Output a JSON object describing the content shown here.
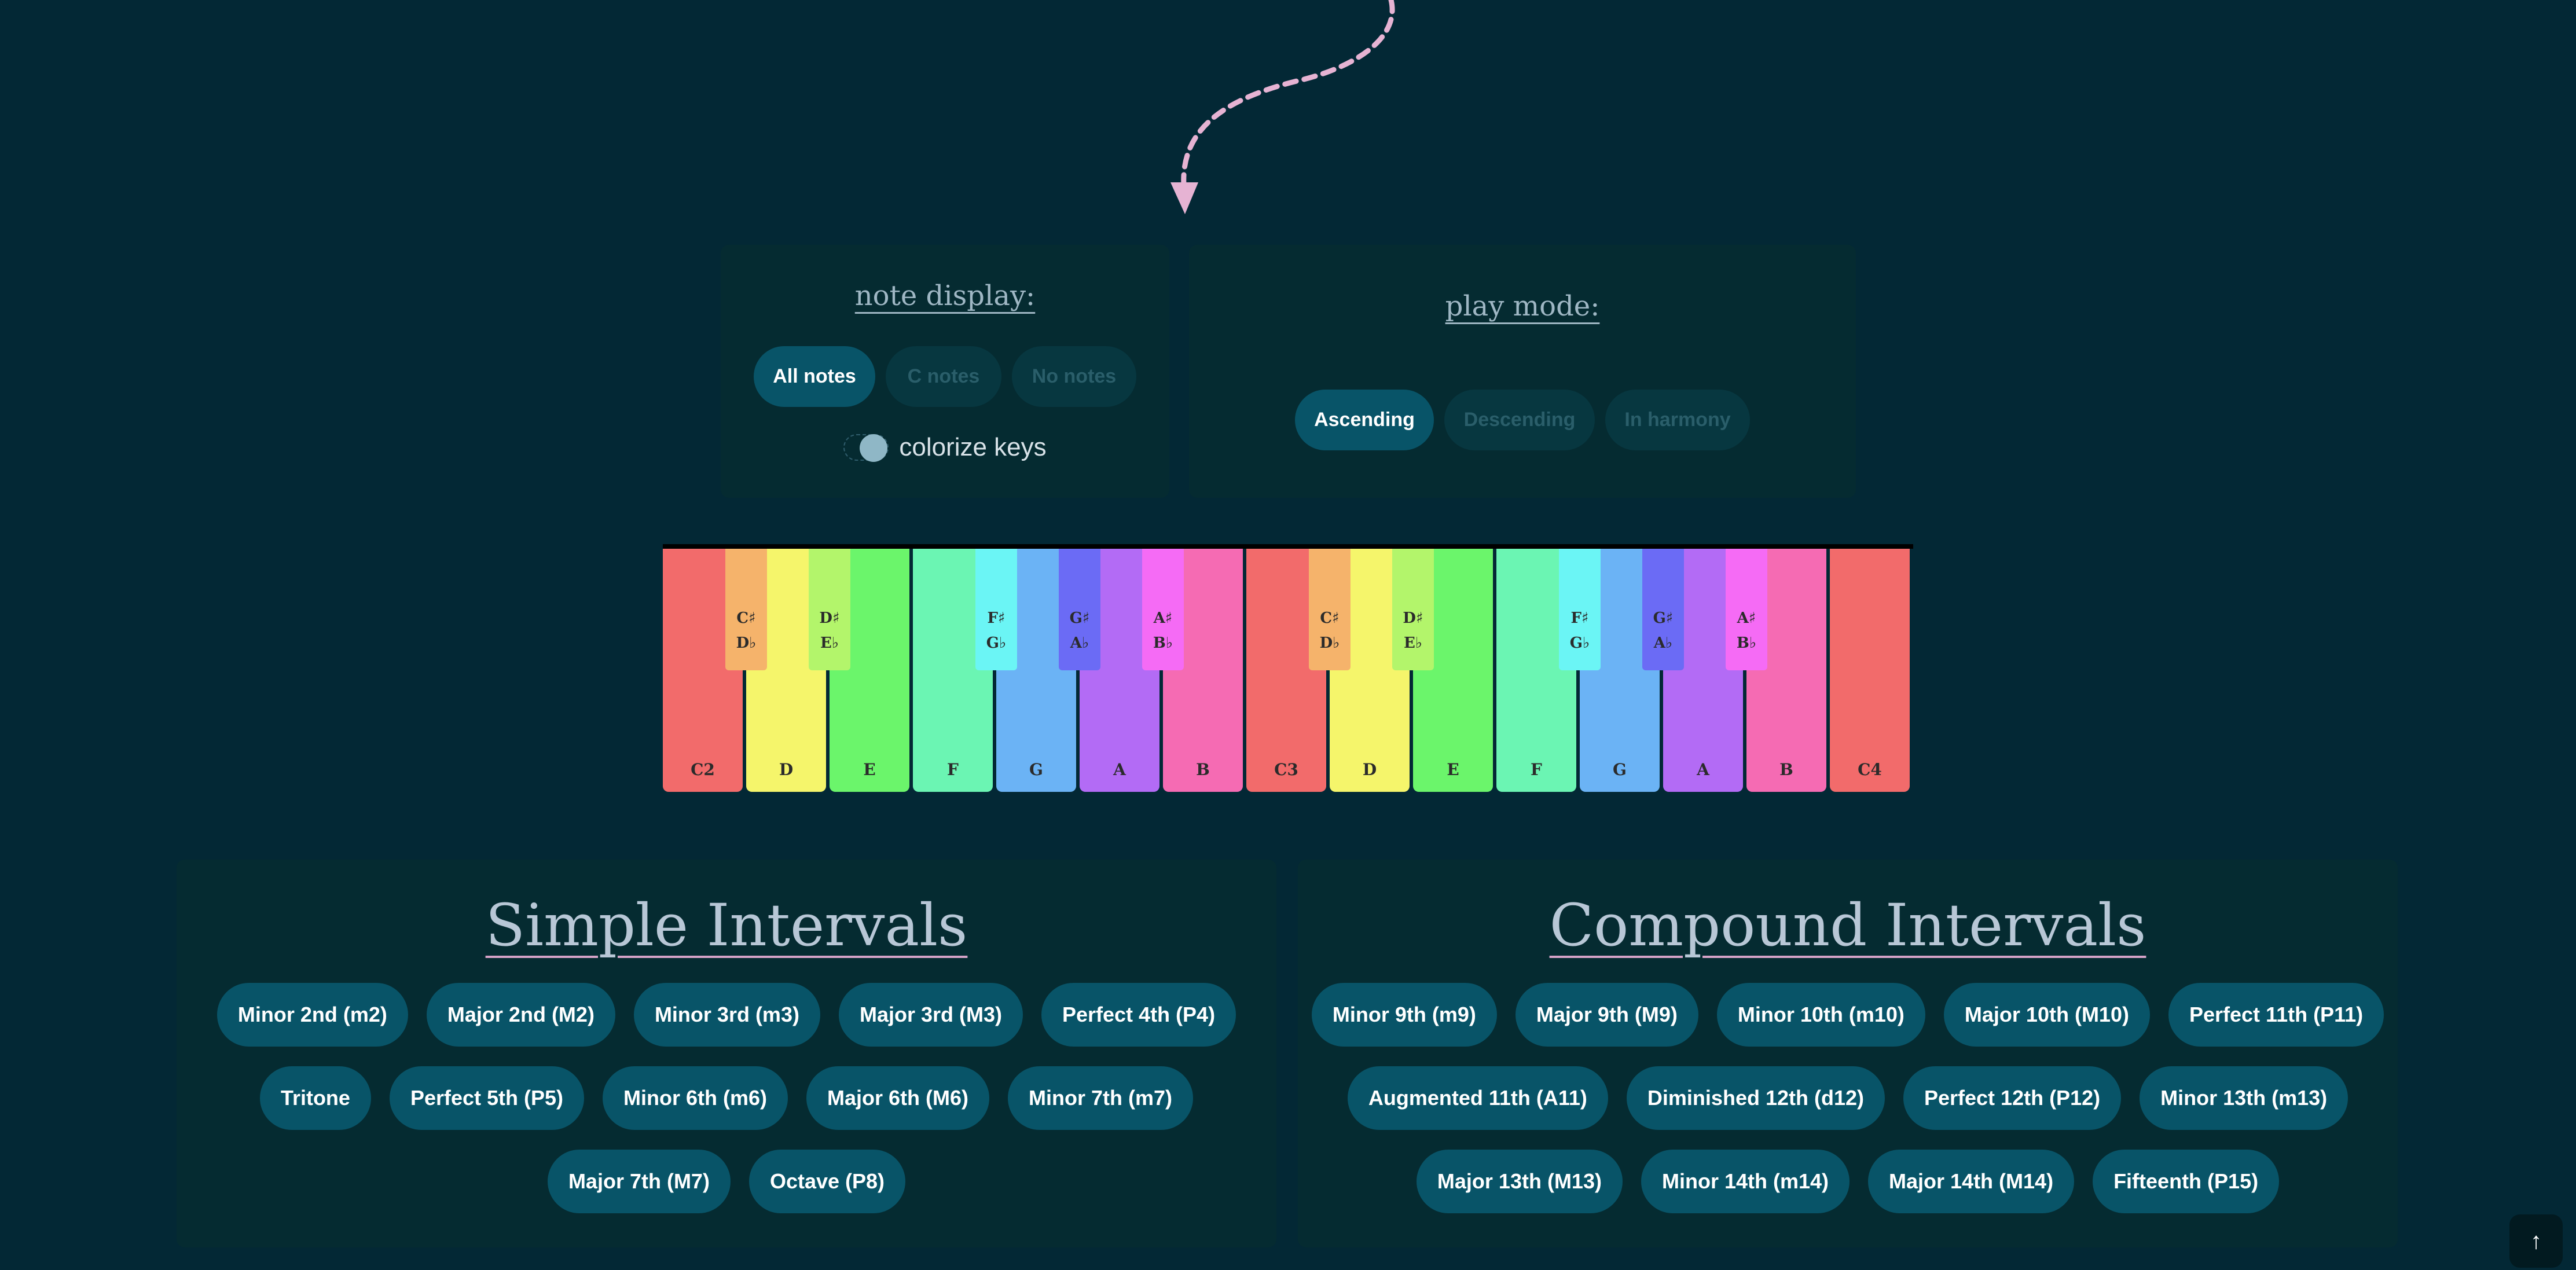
{
  "note_display": {
    "title": "note display:",
    "options": [
      {
        "label": "All notes",
        "active": true
      },
      {
        "label": "C notes",
        "active": false
      },
      {
        "label": "No notes",
        "active": false
      }
    ],
    "colorize_label": "colorize keys",
    "colorize_on": true
  },
  "play_mode": {
    "title": "play mode:",
    "options": [
      {
        "label": "Ascending",
        "active": true
      },
      {
        "label": "Descending",
        "active": false
      },
      {
        "label": "In harmony",
        "active": false
      }
    ]
  },
  "keyboard": {
    "white_keys": [
      {
        "label": "C2",
        "color": "#f26b6b"
      },
      {
        "label": "D",
        "color": "#f5f56b"
      },
      {
        "label": "E",
        "color": "#6bf56b"
      },
      {
        "label": "F",
        "color": "#6bf5b3"
      },
      {
        "label": "G",
        "color": "#6bb3f5"
      },
      {
        "label": "A",
        "color": "#b36bf5"
      },
      {
        "label": "B",
        "color": "#f56bb3"
      },
      {
        "label": "C3",
        "color": "#f26b6b"
      },
      {
        "label": "D",
        "color": "#f5f56b"
      },
      {
        "label": "E",
        "color": "#6bf56b"
      },
      {
        "label": "F",
        "color": "#6bf5b3"
      },
      {
        "label": "G",
        "color": "#6bb3f5"
      },
      {
        "label": "A",
        "color": "#b36bf5"
      },
      {
        "label": "B",
        "color": "#f56bb3"
      },
      {
        "label": "C4",
        "color": "#f26b6b"
      }
    ],
    "black_keys": [
      {
        "top": "C♯",
        "bottom": "D♭",
        "color": "#f5b36b"
      },
      {
        "top": "D♯",
        "bottom": "E♭",
        "color": "#b3f56b"
      },
      {
        "top": "F♯",
        "bottom": "G♭",
        "color": "#6bf5f5"
      },
      {
        "top": "G♯",
        "bottom": "A♭",
        "color": "#6b6bf5"
      },
      {
        "top": "A♯",
        "bottom": "B♭",
        "color": "#f56bf5"
      },
      {
        "top": "C♯",
        "bottom": "D♭",
        "color": "#f5b36b"
      },
      {
        "top": "D♯",
        "bottom": "E♭",
        "color": "#b3f56b"
      },
      {
        "top": "F♯",
        "bottom": "G♭",
        "color": "#6bf5f5"
      },
      {
        "top": "G♯",
        "bottom": "A♭",
        "color": "#6b6bf5"
      },
      {
        "top": "A♯",
        "bottom": "B♭",
        "color": "#f56bf5"
      }
    ]
  },
  "simple_intervals": {
    "title": "Simple Intervals",
    "rows": [
      [
        "Minor 2nd (m2)",
        "Major 2nd (M2)",
        "Minor 3rd (m3)",
        "Major 3rd (M3)",
        "Perfect 4th (P4)"
      ],
      [
        "Tritone",
        "Perfect 5th (P5)",
        "Minor 6th (m6)",
        "Major 6th (M6)",
        "Minor 7th (m7)"
      ],
      [
        "Major 7th (M7)",
        "Octave (P8)"
      ]
    ]
  },
  "compound_intervals": {
    "title": "Compound Intervals",
    "rows": [
      [
        "Minor 9th (m9)",
        "Major 9th (M9)",
        "Minor 10th (m10)",
        "Major 10th (M10)",
        "Perfect 11th (P11)"
      ],
      [
        "Augmented 11th (A11)",
        "Diminished 12th (d12)",
        "Perfect 12th (P12)",
        "Minor 13th (m13)"
      ],
      [
        "Major 13th (M13)",
        "Minor 14th (m14)",
        "Major 14th (M14)",
        "Fifteenth (P15)"
      ]
    ]
  },
  "scroll_top_icon": "arrow-up-icon",
  "colors": {
    "background": "#032835",
    "panel": "#052b31",
    "button": "#085468",
    "arrow": "#e6b3d3"
  }
}
